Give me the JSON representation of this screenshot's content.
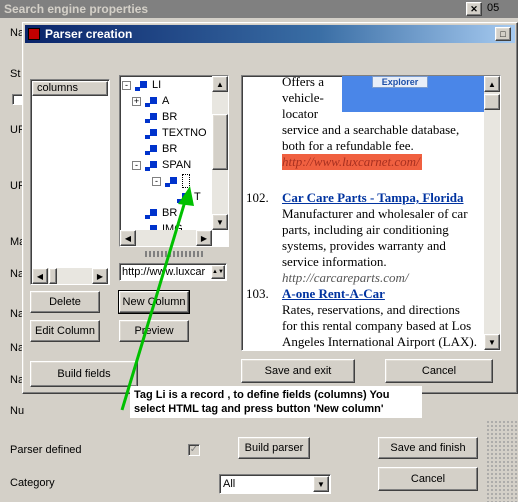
{
  "outer_window": {
    "title": "Search engine properties",
    "edge_text": "05",
    "left_labels": [
      "Na",
      "St",
      "UR",
      "UR",
      "Ma",
      "Na",
      "Na",
      "Na",
      "Na",
      "Nu"
    ],
    "parser_defined_label": "Parser defined",
    "category_label": "Category",
    "category_value": "All",
    "build_parser_label": "Build parser",
    "save_finish_label": "Save and finish",
    "cancel_label": "Cancel"
  },
  "parser_window": {
    "title": "Parser creation",
    "columns_header": "columns",
    "tree": [
      {
        "label": "LI",
        "expander": "-",
        "level": 0
      },
      {
        "label": "A",
        "expander": "+",
        "level": 1
      },
      {
        "label": "BR",
        "expander": "",
        "level": 1
      },
      {
        "label": "TEXTNO",
        "expander": "",
        "level": 1
      },
      {
        "label": "BR",
        "expander": "",
        "level": 1
      },
      {
        "label": "SPAN",
        "expander": "-",
        "level": 1
      },
      {
        "label": "",
        "expander": "-",
        "level": 2
      },
      {
        "label": "T",
        "expander": "",
        "level": 3
      },
      {
        "label": "BR",
        "expander": "",
        "level": 1
      },
      {
        "label": "IMG",
        "expander": "",
        "level": 1
      }
    ],
    "url_field": "http://www.luxcar",
    "buttons": {
      "delete": "Delete",
      "new_column": "New Column",
      "edit_column": "Edit Column",
      "preview": "Preview",
      "build_fields": "Build fields",
      "save_exit": "Save and exit",
      "cancel": "Cancel"
    },
    "preview": {
      "banner_text": "Explorer",
      "top_lines": [
        "Offers a",
        "vehicle-",
        "locator",
        "service and a searchable database,",
        "both for a refundable fee."
      ],
      "top_url": "http://www.luxcarnet.com/",
      "entries": [
        {
          "num": "102.",
          "title": "Car Care Parts - Tampa, Florida",
          "lines": [
            "Manufacturer and wholesaler of car",
            "parts, including air conditioning",
            "systems, provides warranty and",
            "service information."
          ],
          "url": "http://carcareparts.com/"
        },
        {
          "num": "103.",
          "title": "A-one Rent-A-Car",
          "lines": [
            "Rates, reservations, and directions",
            "for this rental company based at Los",
            "Angeles International Airport (LAX)."
          ],
          "url": ""
        }
      ]
    }
  },
  "annotation": {
    "text_line1": "Tag Li is a record , to define fields (columns) You",
    "text_line2": "select HTML tag and press button 'New column'",
    "arrow_color": "#00c000"
  }
}
